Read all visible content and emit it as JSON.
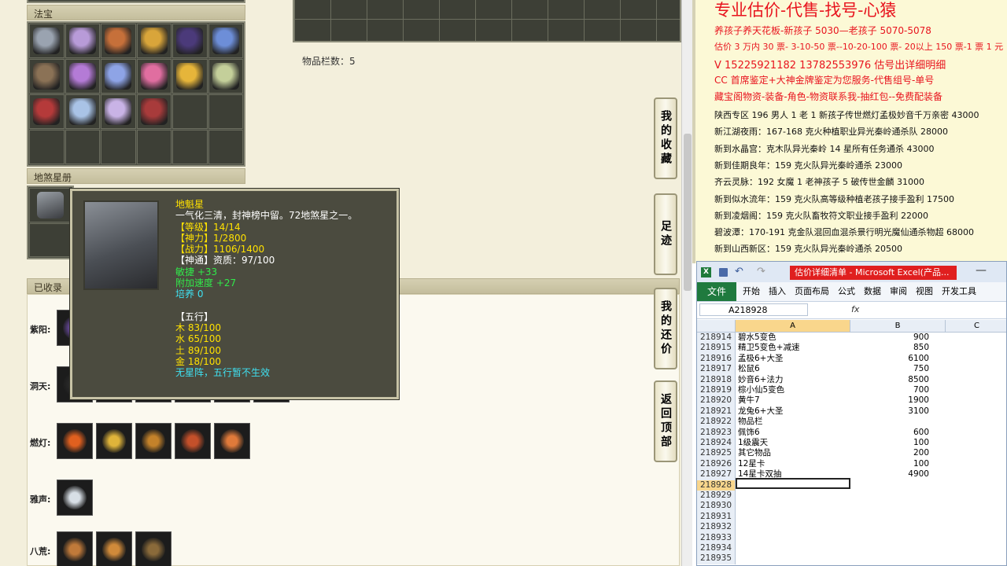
{
  "game": {
    "storage_count_label": "物品栏数：5",
    "fabao_title": "法宝",
    "disha_title": "地煞星册",
    "collected_title": "已收录",
    "fabao_icons": [
      {
        "name": "whip-icon",
        "color": "#9aa3b0"
      },
      {
        "name": "cloth-icon",
        "color": "#b89bd8"
      },
      {
        "name": "lute-icon",
        "color": "#c6703a"
      },
      {
        "name": "pagoda-icon",
        "color": "#d9a53a"
      },
      {
        "name": "dark-orb-icon",
        "color": "#4b3a7a"
      },
      {
        "name": "gauntlet-icon",
        "color": "#6d8ed8"
      },
      {
        "name": "book-icon",
        "color": "#8b7256"
      },
      {
        "name": "ring-icon",
        "color": "#b47bd6"
      },
      {
        "name": "scroll-icon",
        "color": "#8ea4e6"
      },
      {
        "name": "lantern-icon",
        "color": "#e06ea0"
      },
      {
        "name": "flame-cloud-icon",
        "color": "#e6b53a"
      },
      {
        "name": "jade-icon",
        "color": "#c4cf9a"
      },
      {
        "name": "seal-icon",
        "color": "#b53a3a"
      },
      {
        "name": "sword-icon",
        "color": "#a9c3e6"
      },
      {
        "name": "spirit-icon",
        "color": "#c9b3e6"
      },
      {
        "name": "rope-icon",
        "color": "#a83b3b"
      }
    ],
    "collection_rows": [
      {
        "label": "紫阳:",
        "count": 1,
        "colors": [
          "#6a4aa0"
        ]
      },
      {
        "label": "洞天:",
        "count": 6,
        "colors": [
          "#2a2a2a",
          "#2a2a2a",
          "#2a2a2a",
          "#2a2a2a",
          "#2a2a2a",
          "#2a2a2a"
        ]
      },
      {
        "label": "燃灯:",
        "count": 5,
        "colors": [
          "#e0601f",
          "#e0b43a",
          "#c4822a",
          "#c4502a",
          "#e07a3a"
        ]
      },
      {
        "label": "雅声:",
        "count": 1,
        "colors": [
          "#d8dfe6"
        ]
      },
      {
        "label": "八荒:",
        "count": 3,
        "colors": [
          "#c07a3a",
          "#d08a3a",
          "#8a6a3a"
        ]
      }
    ],
    "side_buttons": [
      "我的收藏",
      "足迹",
      "我的还价",
      "返回顶部"
    ],
    "tooltip": {
      "name": "地魁星",
      "desc": "一气化三清，封神榜中留。72地煞星之一。",
      "level": "【等级】14/14",
      "shenli": "【神力】1/2800",
      "zhanli": "【战力】1106/1400",
      "shentong": "【神通】资质：97/100",
      "minsu": "敏捷 +33",
      "speed": "附加速度 +27",
      "peiyang": "培养 0",
      "wuxing_title": "【五行】",
      "mu": "木 83/100",
      "shui": "水 65/100",
      "tu": "土 89/100",
      "jin": "金 18/100",
      "note": "无星阵，五行暂不生效"
    }
  },
  "ad": {
    "headline": "专业估价-代售-找号-心猿",
    "lines_red": [
      "养孩子养天花板-新孩子 5030—老孩子 5070-5078",
      "估价 3 万内 30 票- 3-10-50 票--10-20-100 票- 20以上 150 票-1 票 1 元",
      "V 15225921182    13782553976    估号出详细明细",
      "CC 首席鉴定+大神金牌鉴定为您服务-代售组号-单号",
      "藏宝阁物资-装备-角色-物资联系我-抽红包--免费配装备"
    ],
    "lines_black": [
      "陕西专区 196 男人 1 老 1 新孩子传世燃灯孟极妙音千万亲密 43000",
      "新江湖夜雨：167-168 克火种植职业异光秦岭通杀队 28000",
      "新到水晶宫：克木队异光秦岭 14 星所有任务通杀 43000",
      "新到佳期良年：159 克火队异光秦岭通杀 23000",
      "齐云灵脉：192 女魔 1 老神孩子 5 破传世金麟 31000",
      "新到似水流年：159 克火队高等级种植老孩子接手盈利 17500",
      "新到凌烟阁：159 克火队畜牧符文职业接手盈利 22000",
      "碧波潭：170-191 克金队混回血混杀景行明光魔仙通杀物超 68000",
      "新到山西新区：159 克火队异光秦岭通杀 20500"
    ]
  },
  "excel": {
    "title": "估价详细清单 - Microsoft Excel(产品...",
    "file_tab": "文件",
    "menu": [
      "开始",
      "插入",
      "页面布局",
      "公式",
      "数据",
      "审阅",
      "视图",
      "开发工具"
    ],
    "name_box": "A218928",
    "fx": "fx",
    "col_headers": [
      "A",
      "B",
      "C"
    ],
    "rows": [
      {
        "n": "218914",
        "a": "碧水5变色",
        "b": "900"
      },
      {
        "n": "218915",
        "a": "精卫5变色+减速",
        "b": "850"
      },
      {
        "n": "218916",
        "a": "孟极6+大圣",
        "b": "6100"
      },
      {
        "n": "218917",
        "a": "松鼠6",
        "b": "750"
      },
      {
        "n": "218918",
        "a": "妙音6+法力",
        "b": "8500"
      },
      {
        "n": "218919",
        "a": "棕小仙5变色",
        "b": "700"
      },
      {
        "n": "218920",
        "a": "黄牛7",
        "b": "1900"
      },
      {
        "n": "218921",
        "a": "龙兔6+大圣",
        "b": "3100"
      },
      {
        "n": "218922",
        "a": "物品栏",
        "b": ""
      },
      {
        "n": "218923",
        "a": "佩饰6",
        "b": "600"
      },
      {
        "n": "218924",
        "a": "1级震天",
        "b": "100"
      },
      {
        "n": "218925",
        "a": "其它物品",
        "b": "200"
      },
      {
        "n": "218926",
        "a": "12星卡",
        "b": "100"
      },
      {
        "n": "218927",
        "a": "14星卡双抽",
        "b": "4900"
      },
      {
        "n": "218928",
        "a": "",
        "b": ""
      },
      {
        "n": "218929",
        "a": "",
        "b": ""
      },
      {
        "n": "218930",
        "a": "",
        "b": ""
      },
      {
        "n": "218931",
        "a": "",
        "b": ""
      },
      {
        "n": "218932",
        "a": "",
        "b": ""
      },
      {
        "n": "218933",
        "a": "",
        "b": ""
      },
      {
        "n": "218934",
        "a": "",
        "b": ""
      },
      {
        "n": "218935",
        "a": "",
        "b": ""
      }
    ]
  }
}
